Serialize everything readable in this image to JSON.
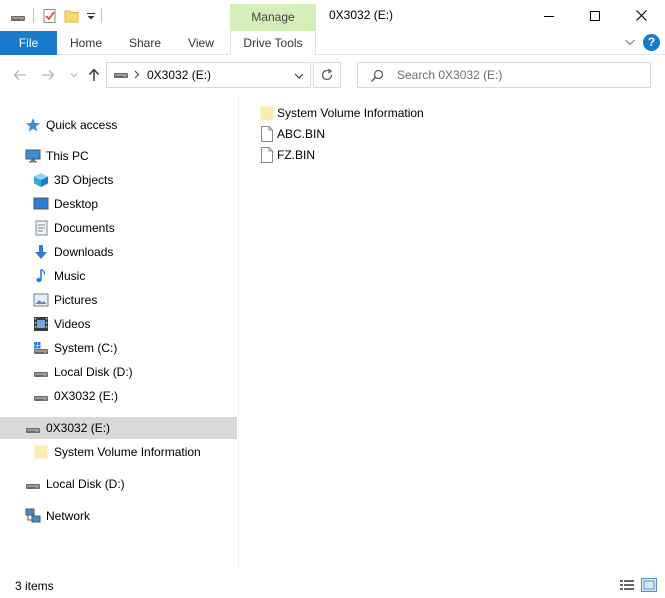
{
  "window": {
    "title": "0X3032 (E:)",
    "manage_tab_label": "Manage"
  },
  "ribbon": {
    "file_label": "File",
    "tabs": [
      {
        "label": "Home"
      },
      {
        "label": "Share"
      },
      {
        "label": "View"
      },
      {
        "label": "Drive Tools"
      }
    ],
    "help_glyph": "?"
  },
  "nav": {
    "address_path": "0X3032 (E:)",
    "search_placeholder": "Search 0X3032 (E:)"
  },
  "sidebar": {
    "items": [
      {
        "label": "Quick access",
        "icon": "star-icon"
      },
      {
        "label": "This PC",
        "icon": "computer-icon"
      },
      {
        "label": "3D Objects",
        "icon": "cube-icon"
      },
      {
        "label": "Desktop",
        "icon": "desktop-icon"
      },
      {
        "label": "Documents",
        "icon": "documents-icon"
      },
      {
        "label": "Downloads",
        "icon": "downloads-icon"
      },
      {
        "label": "Music",
        "icon": "music-icon"
      },
      {
        "label": "Pictures",
        "icon": "pictures-icon"
      },
      {
        "label": "Videos",
        "icon": "videos-icon"
      },
      {
        "label": "System (C:)",
        "icon": "system-drive-icon"
      },
      {
        "label": "Local Disk (D:)",
        "icon": "drive-icon"
      },
      {
        "label": "0X3032 (E:)",
        "icon": "drive-icon"
      },
      {
        "label": "0X3032 (E:)",
        "icon": "drive-icon",
        "selected": true
      },
      {
        "label": "System Volume Information",
        "icon": "folder-icon"
      },
      {
        "label": "Local Disk (D:)",
        "icon": "drive-icon"
      },
      {
        "label": "Network",
        "icon": "network-icon"
      }
    ]
  },
  "files": [
    {
      "name": "System Volume Information",
      "icon": "folder-icon"
    },
    {
      "name": "ABC.BIN",
      "icon": "file-icon"
    },
    {
      "name": "FZ.BIN",
      "icon": "file-icon"
    }
  ],
  "status": {
    "item_count": "3 items"
  },
  "colors": {
    "file_tab": "#1979ca",
    "manage_tab": "#d4f0b8",
    "selected_row": "#d9d9d9",
    "folder": "#fcebb0"
  }
}
